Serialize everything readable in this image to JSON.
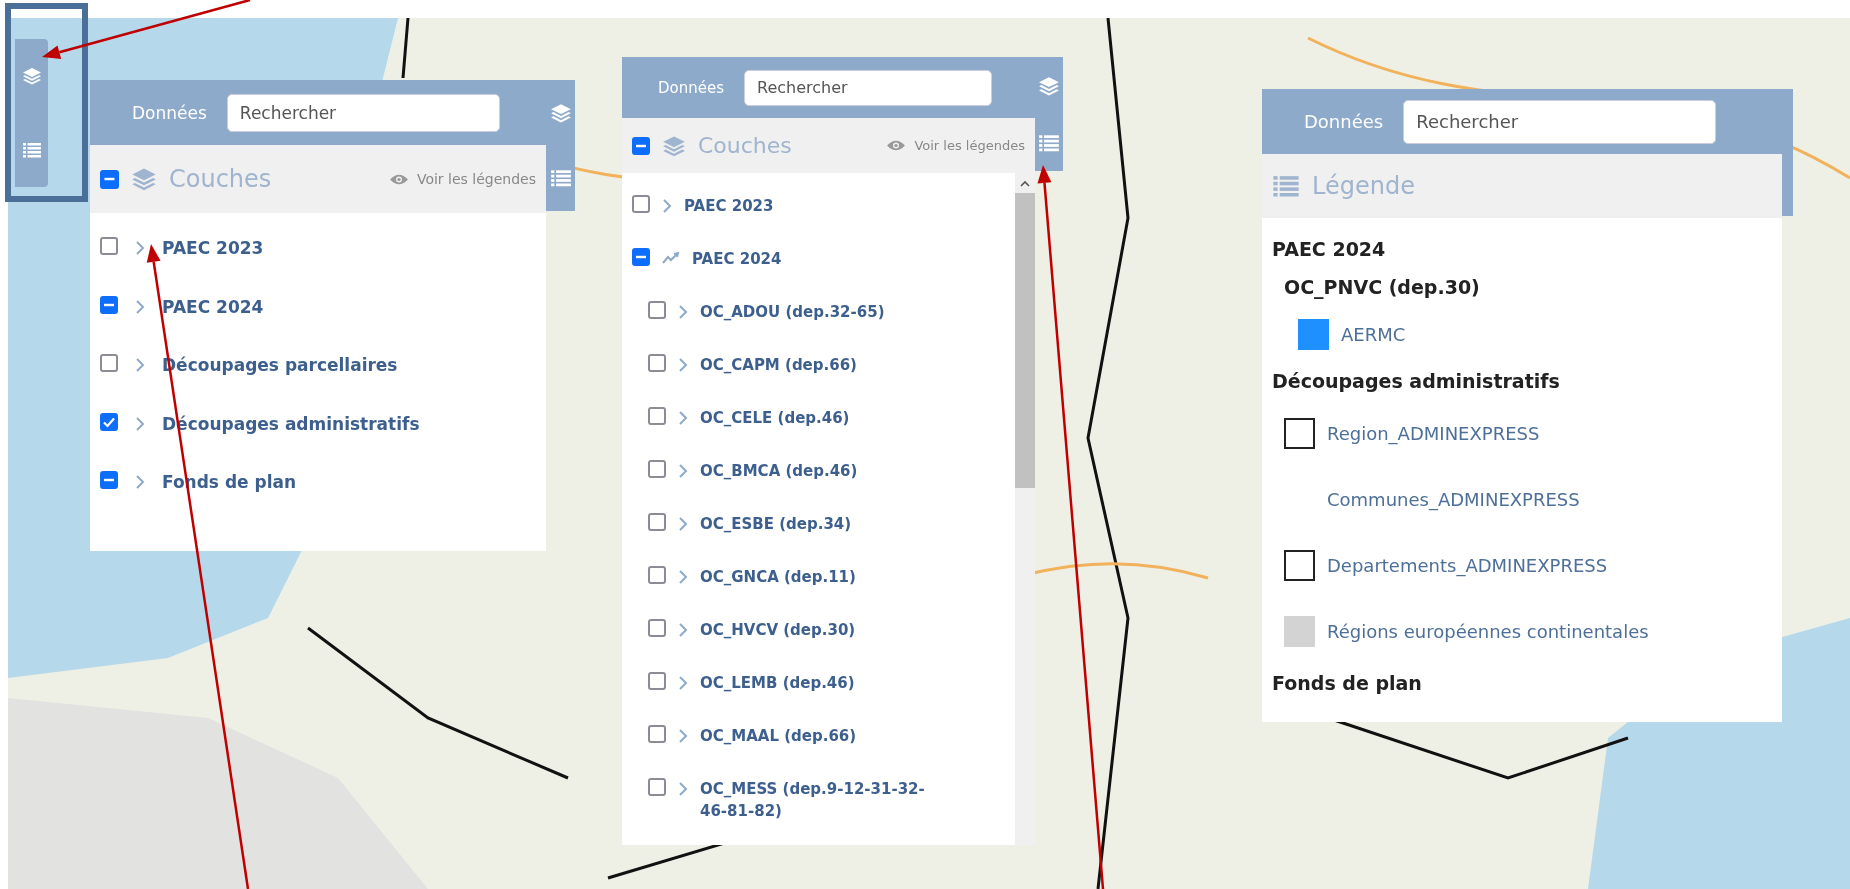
{
  "panels": [
    {
      "kind": "layers",
      "tab_label": "Données",
      "search": {
        "placeholder": "Rechercher"
      },
      "section_title": "Couches",
      "section_checkbox": {
        "checked": true,
        "indeterminate": true
      },
      "legend_link": "Voir les légendes",
      "scrollbar": false,
      "layers": [
        {
          "label": "PAEC 2023",
          "checked": false,
          "indeterminate": false,
          "expanded": false
        },
        {
          "label": "PAEC 2024",
          "checked": true,
          "indeterminate": true,
          "expanded": false
        },
        {
          "label": "Découpages parcellaires",
          "checked": false,
          "indeterminate": false,
          "expanded": false
        },
        {
          "label": "Découpages administratifs",
          "checked": true,
          "indeterminate": false,
          "expanded": false
        },
        {
          "label": "Fonds de plan",
          "checked": true,
          "indeterminate": true,
          "expanded": false
        }
      ]
    },
    {
      "kind": "layers",
      "tab_label": "Données",
      "search": {
        "placeholder": "Rechercher"
      },
      "section_title": "Couches",
      "section_checkbox": {
        "checked": true,
        "indeterminate": true
      },
      "legend_link": "Voir les légendes",
      "scrollbar": true,
      "layers": [
        {
          "label": "PAEC 2023",
          "checked": false,
          "indeterminate": false,
          "expanded": false
        },
        {
          "label": "PAEC 2024",
          "checked": true,
          "indeterminate": true,
          "expanded": true,
          "children": [
            {
              "label": "OC_ADOU (dep.32-65)",
              "checked": false,
              "indeterminate": false,
              "expanded": false
            },
            {
              "label": "OC_CAPM (dep.66)",
              "checked": false,
              "indeterminate": false,
              "expanded": false
            },
            {
              "label": "OC_CELE (dep.46)",
              "checked": false,
              "indeterminate": false,
              "expanded": false
            },
            {
              "label": "OC_BMCA (dep.46)",
              "checked": false,
              "indeterminate": false,
              "expanded": false
            },
            {
              "label": "OC_ESBE (dep.34)",
              "checked": false,
              "indeterminate": false,
              "expanded": false
            },
            {
              "label": "OC_GNCA (dep.11)",
              "checked": false,
              "indeterminate": false,
              "expanded": false
            },
            {
              "label": "OC_HVCV (dep.30)",
              "checked": false,
              "indeterminate": false,
              "expanded": false
            },
            {
              "label": "OC_LEMB (dep.46)",
              "checked": false,
              "indeterminate": false,
              "expanded": false
            },
            {
              "label": "OC_MAAL (dep.66)",
              "checked": false,
              "indeterminate": false,
              "expanded": false
            },
            {
              "label": "OC_MESS (dep.9-12-31-32-46-81-82)",
              "checked": false,
              "indeterminate": false,
              "expanded": false
            }
          ]
        }
      ]
    },
    {
      "kind": "legend",
      "tab_label": "Données",
      "search": {
        "placeholder": "Rechercher"
      },
      "section_title": "Légende",
      "groups": [
        {
          "title": "PAEC 2024",
          "subgroups": [
            {
              "title": "OC_PNVC (dep.30)",
              "items": [
                {
                  "label": "AERMC",
                  "kind": "fill",
                  "color": "#1e90ff"
                }
              ]
            }
          ]
        },
        {
          "title": "Découpages administratifs",
          "items": [
            {
              "label": "Region_ADMINEXPRESS",
              "kind": "outline"
            },
            {
              "label": "Communes_ADMINEXPRESS",
              "kind": "none"
            },
            {
              "label": "Departements_ADMINEXPRESS",
              "kind": "outline"
            },
            {
              "label": "Régions européennes continentales",
              "kind": "fill",
              "color": "#d3d3d3"
            }
          ]
        },
        {
          "title": "Fonds de plan"
        }
      ]
    }
  ]
}
